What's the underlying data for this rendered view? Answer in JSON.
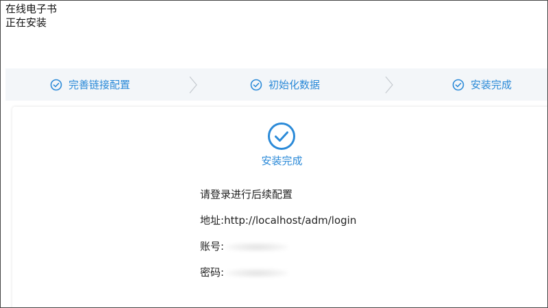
{
  "app": {
    "title": "在线电子书",
    "subtitle": "正在安装"
  },
  "steps": [
    {
      "label": "完善链接配置",
      "state": "done"
    },
    {
      "label": "初始化数据",
      "state": "done"
    },
    {
      "label": "安装完成",
      "state": "done"
    }
  ],
  "result": {
    "title": "安装完成",
    "instruction": "请登录进行后续配置",
    "address_label": "地址:",
    "address_value": "http://localhost/adm/login",
    "account_label": "账号:",
    "password_label": "密码:"
  },
  "colors": {
    "accent": "#2b8ad8",
    "steps_bg": "#f3f6f9",
    "separator": "#c7ccd1"
  },
  "icons": {
    "step_done": "circle-check-icon",
    "separator": "chevron-right-icon",
    "success": "circle-check-icon"
  }
}
